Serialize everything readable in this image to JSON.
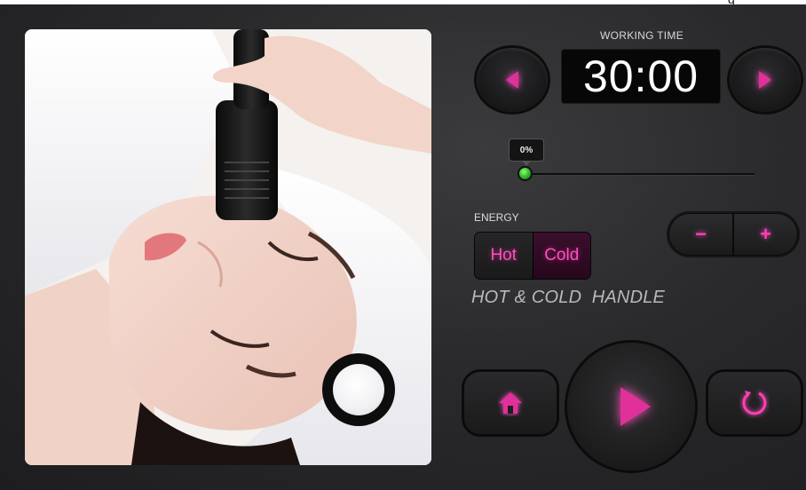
{
  "header": {
    "cutoff_text": "g"
  },
  "working_time": {
    "label": "WORKING TIME",
    "value": "30:00",
    "decrease_icon": "triangle-left-icon",
    "increase_icon": "triangle-right-icon"
  },
  "slider": {
    "tooltip": "0%",
    "value_percent": 0
  },
  "energy": {
    "label": "ENERGY",
    "hot_label": "Hot",
    "cold_label": "Cold",
    "selected": "Cold",
    "minus_label": "−",
    "plus_label": "+"
  },
  "handle_title": "HOT & COLD  HANDLE",
  "controls": {
    "home_icon": "home-icon",
    "play_icon": "play-icon",
    "reset_icon": "refresh-icon"
  },
  "colors": {
    "accent": "#e0309a",
    "background": "#2a2a2c",
    "slider_knob": "#2fb22a"
  }
}
